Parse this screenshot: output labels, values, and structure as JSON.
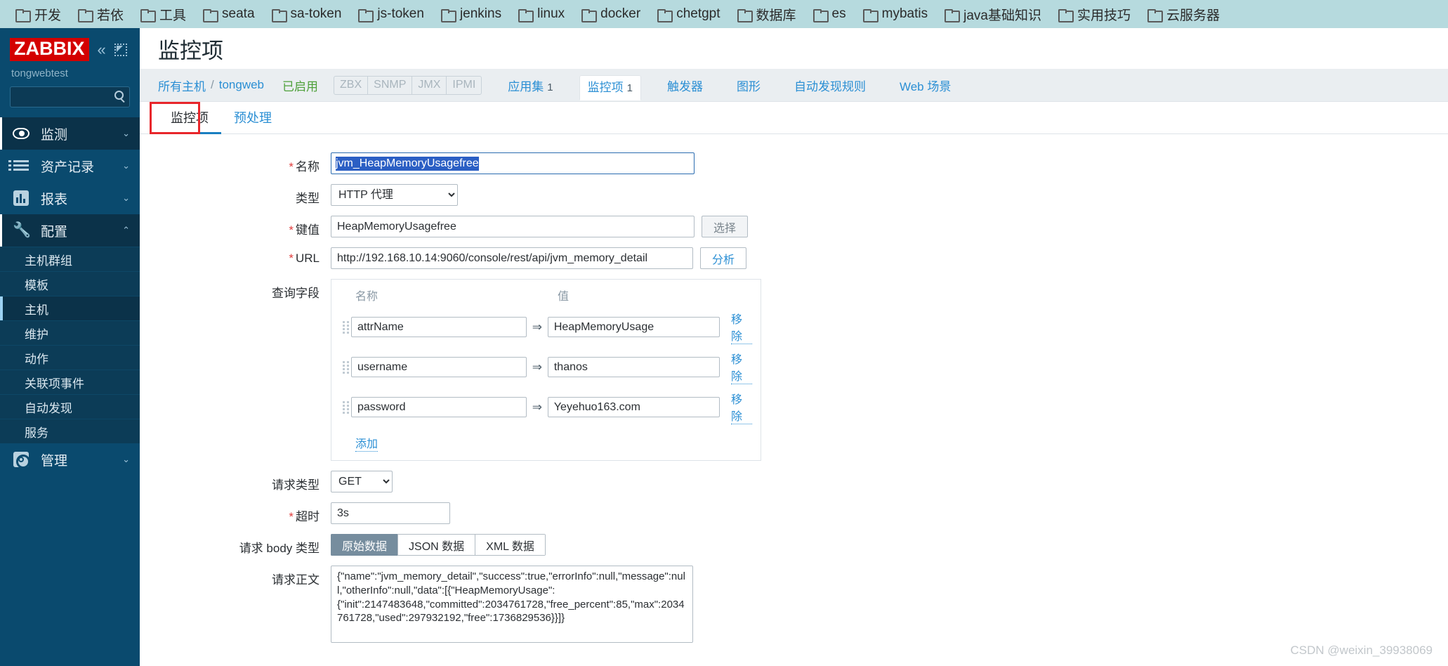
{
  "browser": {
    "bookmarks": [
      {
        "label": "开发",
        "icon": "folder-icon"
      },
      {
        "label": "若依",
        "icon": "folder-icon"
      },
      {
        "label": "工具",
        "icon": "folder-icon"
      },
      {
        "label": "seata",
        "icon": "folder-icon"
      },
      {
        "label": "sa-token",
        "icon": "folder-icon"
      },
      {
        "label": "js-token",
        "icon": "folder-icon"
      },
      {
        "label": "jenkins",
        "icon": "folder-icon"
      },
      {
        "label": "linux",
        "icon": "folder-icon"
      },
      {
        "label": "docker",
        "icon": "folder-icon"
      },
      {
        "label": "chetgpt",
        "icon": "folder-icon"
      },
      {
        "label": "数据库",
        "icon": "folder-icon"
      },
      {
        "label": "es",
        "icon": "folder-icon"
      },
      {
        "label": "mybatis",
        "icon": "folder-icon"
      },
      {
        "label": "java基础知识",
        "icon": "folder-icon"
      },
      {
        "label": "实用技巧",
        "icon": "folder-icon"
      },
      {
        "label": "云服务器",
        "icon": "folder-icon"
      }
    ]
  },
  "sidebar": {
    "logo": "ZABBIX",
    "collapse_glyph": "«",
    "server_name": "tongwebtest",
    "search_placeholder": "",
    "search_value": "",
    "nav": [
      {
        "label": "监测",
        "icon": "eye-icon",
        "chevron": "⌄",
        "active": true
      },
      {
        "label": "资产记录",
        "icon": "list-icon",
        "chevron": "⌄",
        "active": false
      },
      {
        "label": "报表",
        "icon": "report-icon",
        "chevron": "⌄",
        "active": false
      },
      {
        "label": "配置",
        "icon": "wrench-icon",
        "chevron": "⌃",
        "active": true
      }
    ],
    "submenu": [
      {
        "label": "主机群组",
        "active": false
      },
      {
        "label": "模板",
        "active": false
      },
      {
        "label": "主机",
        "active": true
      },
      {
        "label": "维护",
        "active": false
      },
      {
        "label": "动作",
        "active": false
      },
      {
        "label": "关联项事件",
        "active": false
      },
      {
        "label": "自动发现",
        "active": false
      },
      {
        "label": "服务",
        "active": false
      }
    ],
    "admin": {
      "label": "管理",
      "icon": "gear-icon",
      "chevron": "⌄"
    }
  },
  "header": {
    "title": "监控项"
  },
  "breadcrumb": {
    "all_hosts": "所有主机",
    "separator": "/",
    "host": "tongweb",
    "status": "已启用",
    "protocols": [
      "ZBX",
      "SNMP",
      "JMX",
      "IPMI"
    ],
    "tabs": [
      {
        "label": "应用集",
        "count": "1",
        "current": false
      },
      {
        "label": "监控项",
        "count": "1",
        "current": true
      },
      {
        "label": "触发器",
        "count": "",
        "current": false
      },
      {
        "label": "图形",
        "count": "",
        "current": false
      },
      {
        "label": "自动发现规则",
        "count": "",
        "current": false
      },
      {
        "label": "Web 场景",
        "count": "",
        "current": false
      }
    ]
  },
  "form_tabs": [
    {
      "label": "监控项",
      "active": true
    },
    {
      "label": "预处理",
      "active": false
    }
  ],
  "form": {
    "name_label": "名称",
    "name_value": "jvm_HeapMemoryUsagefree",
    "type_label": "类型",
    "type_value": "HTTP 代理",
    "type_options": [
      "HTTP 代理"
    ],
    "key_label": "键值",
    "key_value": "HeapMemoryUsagefree",
    "key_select_button": "选择",
    "url_label": "URL",
    "url_value": "http://192.168.10.14:9060/console/rest/api/jvm_memory_detail",
    "url_parse_button": "分析",
    "query_fields_label": "查询字段",
    "query_col_name": "名称",
    "query_col_value": "值",
    "query_arrow": "⇒",
    "query_fields": [
      {
        "name": "attrName",
        "value": "HeapMemoryUsage",
        "remove": "移除"
      },
      {
        "name": "username",
        "value": "thanos",
        "remove": "移除"
      },
      {
        "name": "password",
        "value": "Yeyehuo163.com",
        "remove": "移除"
      }
    ],
    "query_add": "添加",
    "request_type_label": "请求类型",
    "request_type_value": "GET",
    "request_type_options": [
      "GET"
    ],
    "timeout_label": "超时",
    "timeout_value": "3s",
    "body_type_label": "请求 body 类型",
    "body_types": [
      {
        "label": "原始数据",
        "on": true
      },
      {
        "label": "JSON 数据",
        "on": false
      },
      {
        "label": "XML 数据",
        "on": false
      }
    ],
    "posts_label": "请求正文",
    "posts_value": "{\"name\":\"jvm_memory_detail\",\"success\":true,\"errorInfo\":null,\"message\":null,\"otherInfo\":null,\"data\":[{\"HeapMemoryUsage\":\n{\"init\":2147483648,\"committed\":2034761728,\"free_percent\":85,\"max\":2034761728,\"used\":297932192,\"free\":1736829536}}]}"
  },
  "watermark": "CSDN @weixin_39938069"
}
